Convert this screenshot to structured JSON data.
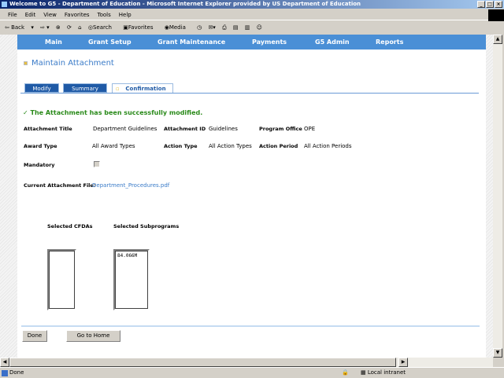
{
  "window": {
    "title": "Welcome to G5 - Department of Education - Microsoft Internet Explorer provided by US Department of Education",
    "minimize": "_",
    "maximize": "□",
    "close": "×"
  },
  "menu": [
    "File",
    "Edit",
    "View",
    "Favorites",
    "Tools",
    "Help"
  ],
  "toolbar": {
    "back": "Back",
    "search": "Search",
    "favorites": "Favorites",
    "media": "Media"
  },
  "nav": [
    "Main",
    "Grant Setup",
    "Grant Maintenance",
    "Payments",
    "G5 Admin",
    "Reports"
  ],
  "page": {
    "title": "Maintain Attachment",
    "tabs": [
      {
        "label": "Modify",
        "active": false
      },
      {
        "label": "Summary",
        "active": false
      },
      {
        "label": "Confirmation",
        "active": true
      }
    ],
    "success": "The Attachment has been successfully modified.",
    "fields": {
      "attachment_title_label": "Attachment Title",
      "attachment_title": "Department Guidelines",
      "attachment_id_label": "Attachment ID",
      "attachment_id": "Guidelines",
      "program_office_label": "Program Office",
      "program_office": "OPE",
      "award_type_label": "Award Type",
      "award_type": "All Award Types",
      "action_type_label": "Action Type",
      "action_type": "All Action Types",
      "action_period_label": "Action Period",
      "action_period": "All Action Periods",
      "mandatory_label": "Mandatory",
      "mandatory": false,
      "file_label": "Current Attachment File:",
      "file": "Department_Procedures.pdf"
    },
    "cfdas_label": "Selected CFDAs",
    "cfdas": [],
    "subprograms_label": "Selected Subprograms",
    "subprograms": [
      "84.066M"
    ],
    "done": "Done",
    "home": "Go to Home"
  },
  "status": {
    "text": "Done",
    "zone": "Local intranet"
  },
  "colors": {
    "nav": "#4a8fd6",
    "tab": "#1f5aa6",
    "success": "#2a8a1a",
    "link": "#3a7bc8"
  }
}
